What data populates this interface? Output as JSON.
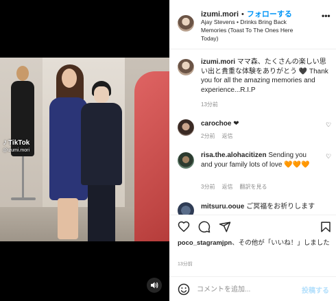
{
  "video": {
    "watermark_brand": "TikTok",
    "watermark_user": "@izumi.mori",
    "icons": {
      "sound": "speaker-icon"
    }
  },
  "header": {
    "username": "izumi.mori",
    "separator": "•",
    "follow_label": "フォローする",
    "audio": "Ajay Stevens • Drinks Bring Back Memories (Toast To The Ones Here Today)",
    "more_icon": "ellipsis-icon"
  },
  "caption": {
    "username": "izumi.mori",
    "text": "ママ森、たくさんの楽しい思い出と貴重な体験をありがとう 🖤 Thank you for all the amazing memories and experience...R.I.P",
    "time": "13分前"
  },
  "comments": [
    {
      "username": "carochoe",
      "text": "❤",
      "time": "2分前",
      "reply": "返信"
    },
    {
      "username": "risa.the.alohacitizen",
      "text": "Sending you and your family lots of love",
      "hearts": "🧡🧡🧡",
      "time": "3分前",
      "reply": "返信",
      "translate": "翻訳を見る"
    },
    {
      "username": "mitsuru.ooue",
      "text": "ご冥福をお祈りします"
    }
  ],
  "actions": {
    "icons": [
      "heart-icon",
      "comment-icon",
      "share-icon",
      "bookmark-icon"
    ]
  },
  "likes": {
    "user": "poco_stagramjpn",
    "text": "、その他が「いいね！」しました",
    "time": "13分前"
  },
  "composer": {
    "placeholder": "コメントを追加...",
    "post_label": "投稿する"
  },
  "colors": {
    "accent": "#0095f6",
    "muted": "#8e8e8e",
    "post_disabled": "#b2dffc",
    "orange_heart": "#f5831f"
  }
}
